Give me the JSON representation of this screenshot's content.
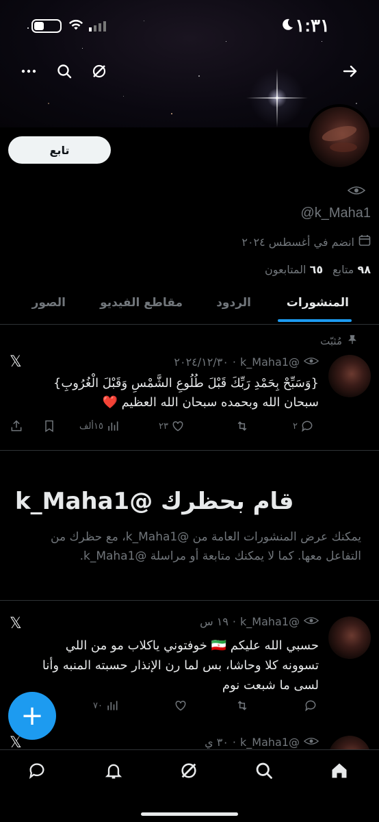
{
  "status_bar": {
    "time": "١:٣١"
  },
  "header_nav": {
    "back_icon": "arrow-right-icon",
    "grok_icon": "grok-icon",
    "search_icon": "search-icon",
    "more_icon": "more-icon"
  },
  "profile": {
    "follow_label": "تابع",
    "handle": "@k_Maha1",
    "joined": "انضم في أغسطس ٢٠٢٤",
    "following_count": "٩٨",
    "following_label": "متابع",
    "followers_count": "٦٥",
    "followers_label": "المتابعون"
  },
  "tabs": [
    {
      "label": "المنشورات",
      "active": true
    },
    {
      "label": "الردود",
      "active": false
    },
    {
      "label": "مقاطع الفيديو",
      "active": false
    },
    {
      "label": "الصور",
      "active": false
    }
  ],
  "pinned_tweet": {
    "pinned_label": "مُثبّت",
    "handle": "@k_Maha1",
    "date": "٢٠٢٤/١٢/٣٠",
    "line1": "{وَسَبِّحْ بِحَمْدِ رَبِّكَ قَبْلَ طُلُوعِ الشَّمْسِ وَقَبْلَ الْغُرُوبِ}",
    "line2": "سبحان الله وبحمده سبحان الله العظيم ❤️",
    "replies": "٢",
    "likes": "٢٣",
    "views": "١٥ألف"
  },
  "blocked": {
    "title": "قام بحظرك @k_Maha1",
    "description": "يمكنك عرض المنشورات العامة من @k_Maha1، مع حظرك من التفاعل معها. كما لا يمكنك متابعة أو مراسلة @k_Maha1."
  },
  "tweet2": {
    "handle": "@k_Maha1",
    "time": "١٩ س",
    "line1": "حسبي الله عليكم 🇮🇷 خوفتوني ياكلاب مو من اللي",
    "line2": "تسوونه كلا وحاشا، بس لما رن الإنذار حسبته المنبه وأنا",
    "line3": "لسى ما شبعت نوم",
    "views": "٧٠"
  },
  "tweet3": {
    "handle": "@k_Maha1",
    "time": "٣٠ ي"
  },
  "fab": {
    "label": "+"
  },
  "colors": {
    "accent": "#1d9bf0",
    "background": "#000000",
    "text_primary": "#e7e9ea",
    "text_secondary": "#71767b",
    "divider": "#2f3336",
    "follow_button_bg": "#eff3f4"
  }
}
